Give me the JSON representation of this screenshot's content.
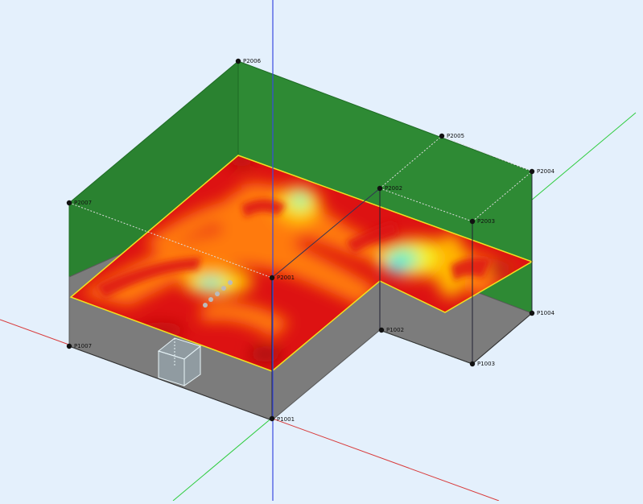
{
  "viewport": {
    "background": "#e4f0fc",
    "colors": {
      "wall": "#2e8a34",
      "wall_dark": "#267a2c",
      "floor": "#7c7c7c",
      "axis_x": "#d83a3a",
      "axis_y": "#2ccc3c",
      "axis_z": "#3a4ae0",
      "heat_hot": "#dd1212",
      "heat_mid": "#ff7a10",
      "heat_warm": "#ffb400",
      "heat_yellow": "#f4f020",
      "heat_cool": "#7df0b8",
      "heat_cold": "#20d0f0"
    }
  },
  "nodes": [
    {
      "id": "p2006",
      "label": "P2006"
    },
    {
      "id": "p2005",
      "label": "P2005"
    },
    {
      "id": "p2004",
      "label": "P2004"
    },
    {
      "id": "p2007",
      "label": "P2007"
    },
    {
      "id": "p2002",
      "label": "P2002"
    },
    {
      "id": "p2003",
      "label": "P2003"
    },
    {
      "id": "p2001",
      "label": "P2001"
    },
    {
      "id": "p1007",
      "label": "P1007"
    },
    {
      "id": "p1002",
      "label": "P1002"
    },
    {
      "id": "p1004",
      "label": "P1004"
    },
    {
      "id": "p1003",
      "label": "P1003"
    },
    {
      "id": "p1001",
      "label": "P1001"
    }
  ]
}
